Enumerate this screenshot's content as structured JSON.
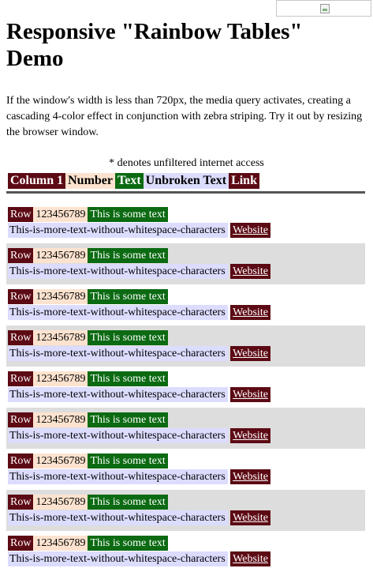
{
  "page": {
    "title": "Responsive \"Rainbow Tables\" Demo",
    "intro": "If the window's width is less than 720px, the media query activates, creating a cascading 4-color effect in conjunction with zebra striping. Try it out by resizing the browser window.",
    "note": "* denotes unfiltered internet access"
  },
  "table": {
    "headers": [
      "Column 1",
      "Number",
      "Text",
      "Unbroken Text",
      "Link"
    ],
    "rows": [
      {
        "col1": "Row",
        "number": "123456789",
        "text": "This is some text",
        "unbroken": "This-is-more-text-without-whitespace-characters",
        "link": "Website"
      },
      {
        "col1": "Row",
        "number": "123456789",
        "text": "This is some text",
        "unbroken": "This-is-more-text-without-whitespace-characters",
        "link": "Website"
      },
      {
        "col1": "Row",
        "number": "123456789",
        "text": "This is some text",
        "unbroken": "This-is-more-text-without-whitespace-characters",
        "link": "Website"
      },
      {
        "col1": "Row",
        "number": "123456789",
        "text": "This is some text",
        "unbroken": "This-is-more-text-without-whitespace-characters",
        "link": "Website"
      },
      {
        "col1": "Row",
        "number": "123456789",
        "text": "This is some text",
        "unbroken": "This-is-more-text-without-whitespace-characters",
        "link": "Website"
      },
      {
        "col1": "Row",
        "number": "123456789",
        "text": "This is some text",
        "unbroken": "This-is-more-text-without-whitespace-characters",
        "link": "Website"
      },
      {
        "col1": "Row",
        "number": "123456789",
        "text": "This is some text",
        "unbroken": "This-is-more-text-without-whitespace-characters",
        "link": "Website"
      },
      {
        "col1": "Row",
        "number": "123456789",
        "text": "This is some text",
        "unbroken": "This-is-more-text-without-whitespace-characters",
        "link": "Website"
      },
      {
        "col1": "Row",
        "number": "123456789",
        "text": "This is some text",
        "unbroken": "This-is-more-text-without-whitespace-characters",
        "link": "Website"
      }
    ]
  },
  "colors": {
    "column1": "#5c0a14",
    "number": "#fde3cf",
    "text": "#0b6a12",
    "unbroken": "#dcdcff",
    "link": "#5c0a14",
    "stripe": "#dddddd"
  },
  "icons": {
    "broken_image": "broken-image-icon"
  }
}
